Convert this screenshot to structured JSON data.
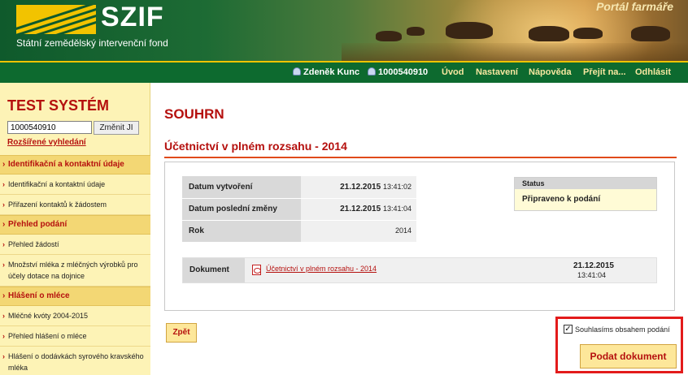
{
  "header": {
    "logo": "SZIF",
    "subtitle": "Státní zemědělský intervenční fond",
    "portal": "Portál farmáře"
  },
  "nav": {
    "user_name": "Zdeněk Kunc",
    "client_id": "1000540910",
    "items": [
      "Úvod",
      "Nastavení",
      "Nápověda",
      "Přejít na...",
      "Odhlásit"
    ]
  },
  "sidebar": {
    "title": "TEST SYSTÉM",
    "search_value": "1000540910",
    "change_label": "Změnit JI",
    "advanced_link": "Rozšířené vyhledání",
    "sections": [
      {
        "label": "Identifikační a kontaktní údaje",
        "items": [
          "Identifikační a kontaktní údaje",
          "Přiřazení kontaktů k žádostem"
        ]
      },
      {
        "label": "Přehled podání",
        "items": [
          "Přehled žádostí",
          "Množství mléka z mléčných výrobků pro účely dotace na dojnice"
        ]
      },
      {
        "label": "Hlášení o mléce",
        "items": [
          "Mléčné kvóty 2004-2015",
          "Přehled hlášení o mléce",
          "Hlášení o dodávkách syrového kravského mléka"
        ]
      }
    ]
  },
  "main": {
    "title": "SOUHRN",
    "subtitle": "Účetnictví v plném rozsahu - 2014",
    "created_label": "Datum vytvoření",
    "created_date": "21.12.2015",
    "created_time": "13:41:02",
    "modified_label": "Datum poslední změny",
    "modified_date": "21.12.2015",
    "modified_time": "13:41:04",
    "year_label": "Rok",
    "year_value": "2014",
    "status_label": "Status",
    "status_value": "Připraveno k podání",
    "document_label": "Dokument",
    "document_link": "Účetnictví v plném rozsahu - 2014",
    "document_date": "21.12.2015",
    "document_time": "13:41:04",
    "back_label": "Zpět",
    "agree_label": "Souhlasíms obsahem podání",
    "submit_label": "Podat dokument"
  }
}
